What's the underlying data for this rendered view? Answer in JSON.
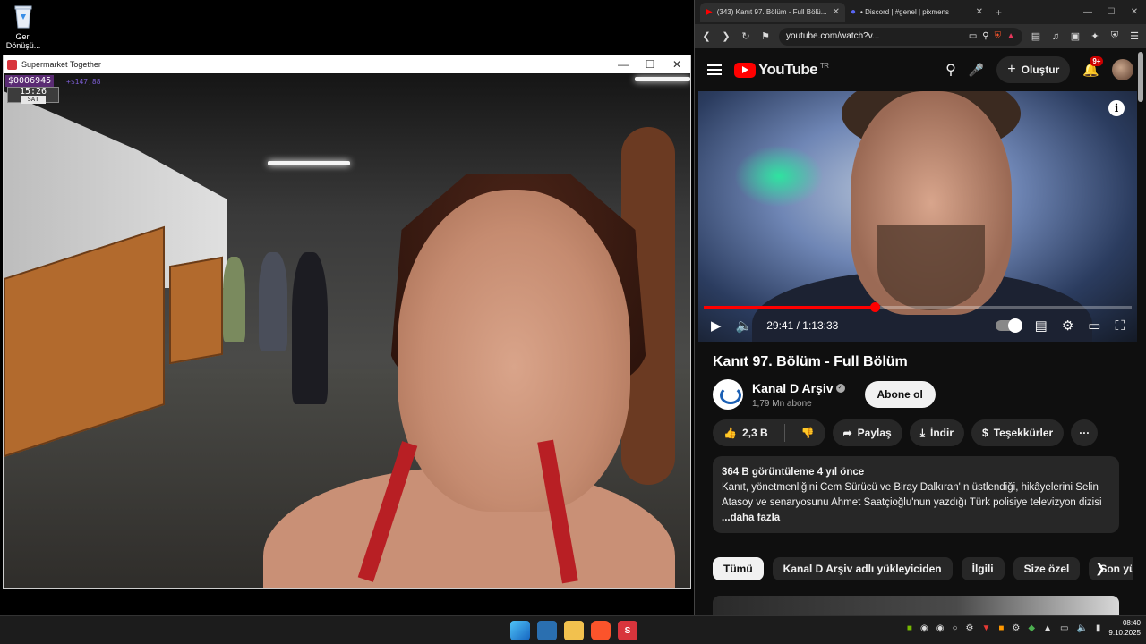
{
  "desktop": {
    "recycle_label": "Geri Dönüşü..."
  },
  "game_window": {
    "title": "Supermarket Together",
    "hud": {
      "money": "$0006945",
      "delta": "+$147,88",
      "time": "15:26",
      "day": "SAT"
    }
  },
  "browser": {
    "tabs": [
      {
        "label": "(343) Kanıt 97. Bölüm - Full Bölü...",
        "active": true
      },
      {
        "label": "• Discord | #genel | pixmens",
        "active": false
      }
    ],
    "url": "youtube.com/watch?v..."
  },
  "youtube": {
    "logo": "YouTube",
    "region": "TR",
    "create_label": "Oluştur",
    "notif_count": "9+",
    "player": {
      "time": "29:41 / 1:13:33",
      "progress": 0.4,
      "info": "i"
    },
    "video_title": "Kanıt 97. Bölüm - Full Bölüm",
    "channel": {
      "name": "Kanal D Arşiv",
      "subs": "1,79 Mn abone",
      "subscribe": "Abone ol"
    },
    "actions": {
      "likes": "2,3 B",
      "share": "Paylaş",
      "download": "İndir",
      "thanks": "Teşekkürler",
      "more": "···"
    },
    "description": {
      "stats": "364 B görüntüleme  4 yıl önce",
      "text": "Kanıt, yönetmenliğini Cem Sürücü ve Biray Dalkıran'ın üstlendiği, hikâyelerini Selin Atasoy ve senaryosunu Ahmet Saatçioğlu'nun yazdığı Türk polisiye televizyon dizisi",
      "more": "...daha fazla"
    },
    "chips": [
      "Tümü",
      "Kanal D Arşiv adlı yükleyiciden",
      "İlgili",
      "Size özel",
      "Son yü..."
    ]
  },
  "taskbar": {
    "time": "08:40",
    "date": "9.10.2025"
  },
  "colors": {
    "yt_red": "#ff0000",
    "yt_bg": "#0f0f0f",
    "chip_bg": "#272727",
    "game_hud": "#5a2b73"
  }
}
